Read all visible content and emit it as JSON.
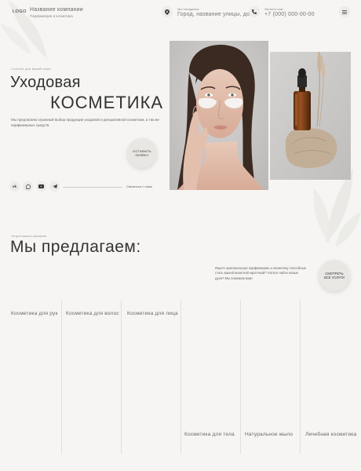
{
  "header": {
    "logo": "LOGO",
    "company_name": "Название компании",
    "company_tagline": "Парфюмерия и косметика",
    "location_label": "Мы находимся:",
    "location_value": "Город, название улицы, дом",
    "phone_label": "Звоните нам",
    "phone_value": "+7 (000) 000-00-00"
  },
  "hero": {
    "eyebrow": "Счастье для вашей кожи",
    "title_line1": "Уходовая",
    "title_line2": "косметика",
    "description": "Мы предлагаем огромный выбор продукции уходовой и декоративной косметики, а так же парфюмерных средств.",
    "cta_label": "Оставить заявку",
    "contact_label": "Связаться с нами",
    "socials": [
      "vk-icon",
      "whatsapp-icon",
      "youtube-icon",
      "telegram-icon"
    ]
  },
  "offer": {
    "eyebrow": "Услуги нашего магазина",
    "title": "Мы предлагаем:",
    "description": "Ищете оригинальную парфюмерию и косметику способные стать вашей визитной карточкой? Хотите найти новые духи? Мы поможем вам!",
    "see_all_label": "Смотреть все услуги"
  },
  "categories": [
    "Косметика для рук",
    "Косметика для волос",
    "Косметика для лица",
    "Косметика для тела",
    "Натуральное мыло",
    "Лечебная косметика"
  ]
}
